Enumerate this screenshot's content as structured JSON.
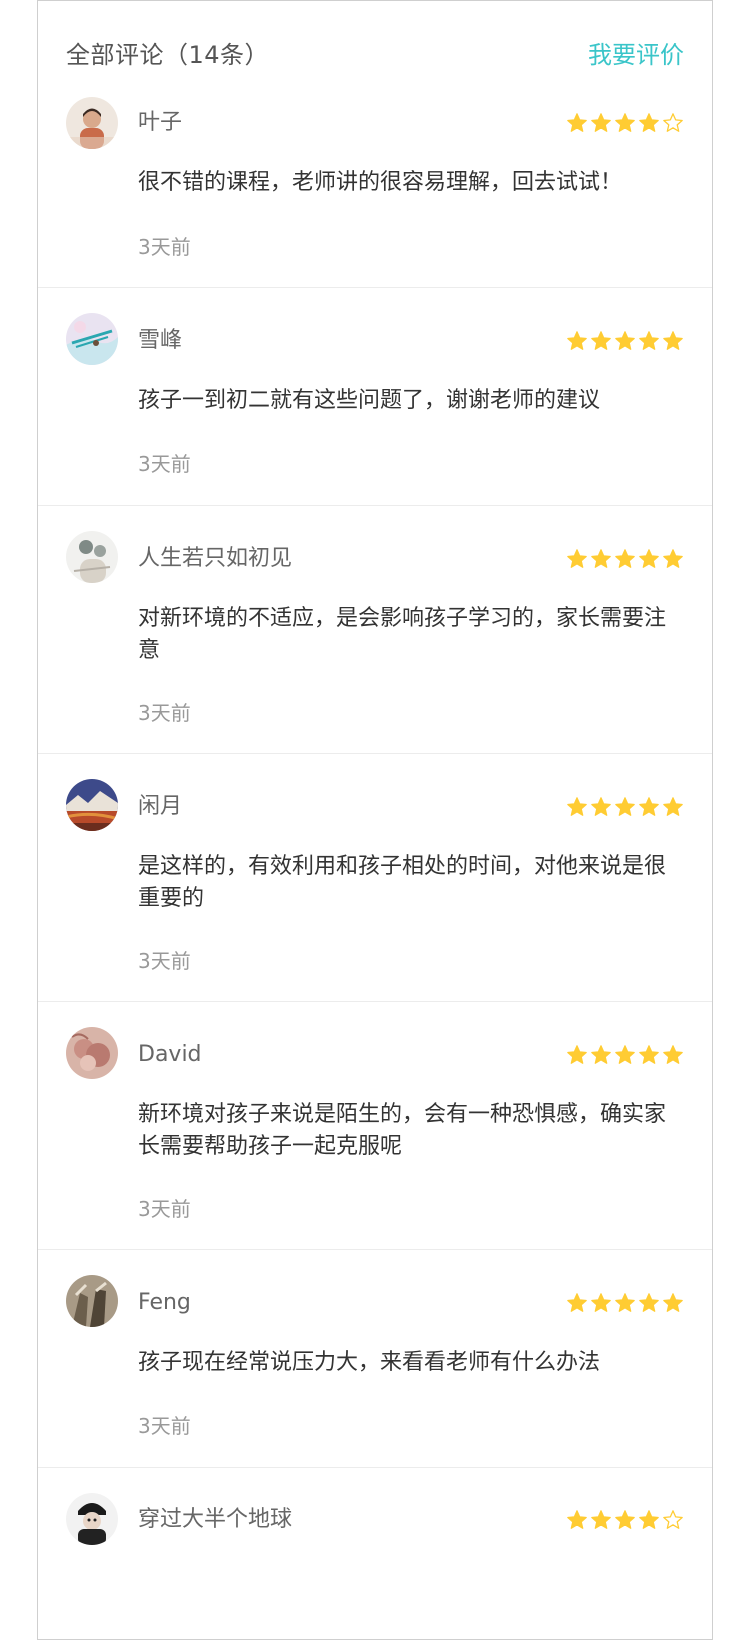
{
  "header": {
    "title": "全部评论（14条）",
    "action_label": "我要评价",
    "action_color": "#3ac5c9"
  },
  "star_color": "#ffcc33",
  "comments": [
    {
      "name": "叶子",
      "rating": 4,
      "text": "很不错的课程，老师讲的很容易理解，回去试试！",
      "time": "3天前"
    },
    {
      "name": "雪峰",
      "rating": 5,
      "text": "孩子一到初二就有这些问题了，谢谢老师的建议",
      "time": "3天前"
    },
    {
      "name": "人生若只如初见",
      "rating": 5,
      "text": "对新环境的不适应，是会影响孩子学习的，家长需要注意",
      "time": "3天前"
    },
    {
      "name": "闲月",
      "rating": 5,
      "text": "是这样的，有效利用和孩子相处的时间，对他来说是很重要的",
      "time": "3天前"
    },
    {
      "name": "David",
      "rating": 5,
      "text": "新环境对孩子来说是陌生的，会有一种恐惧感，确实家长需要帮助孩子一起克服呢",
      "time": "3天前"
    },
    {
      "name": "Feng",
      "rating": 5,
      "text": "孩子现在经常说压力大，来看看老师有什么办法",
      "time": "3天前"
    },
    {
      "name": "穿过大半个地球",
      "rating": 4
    }
  ]
}
